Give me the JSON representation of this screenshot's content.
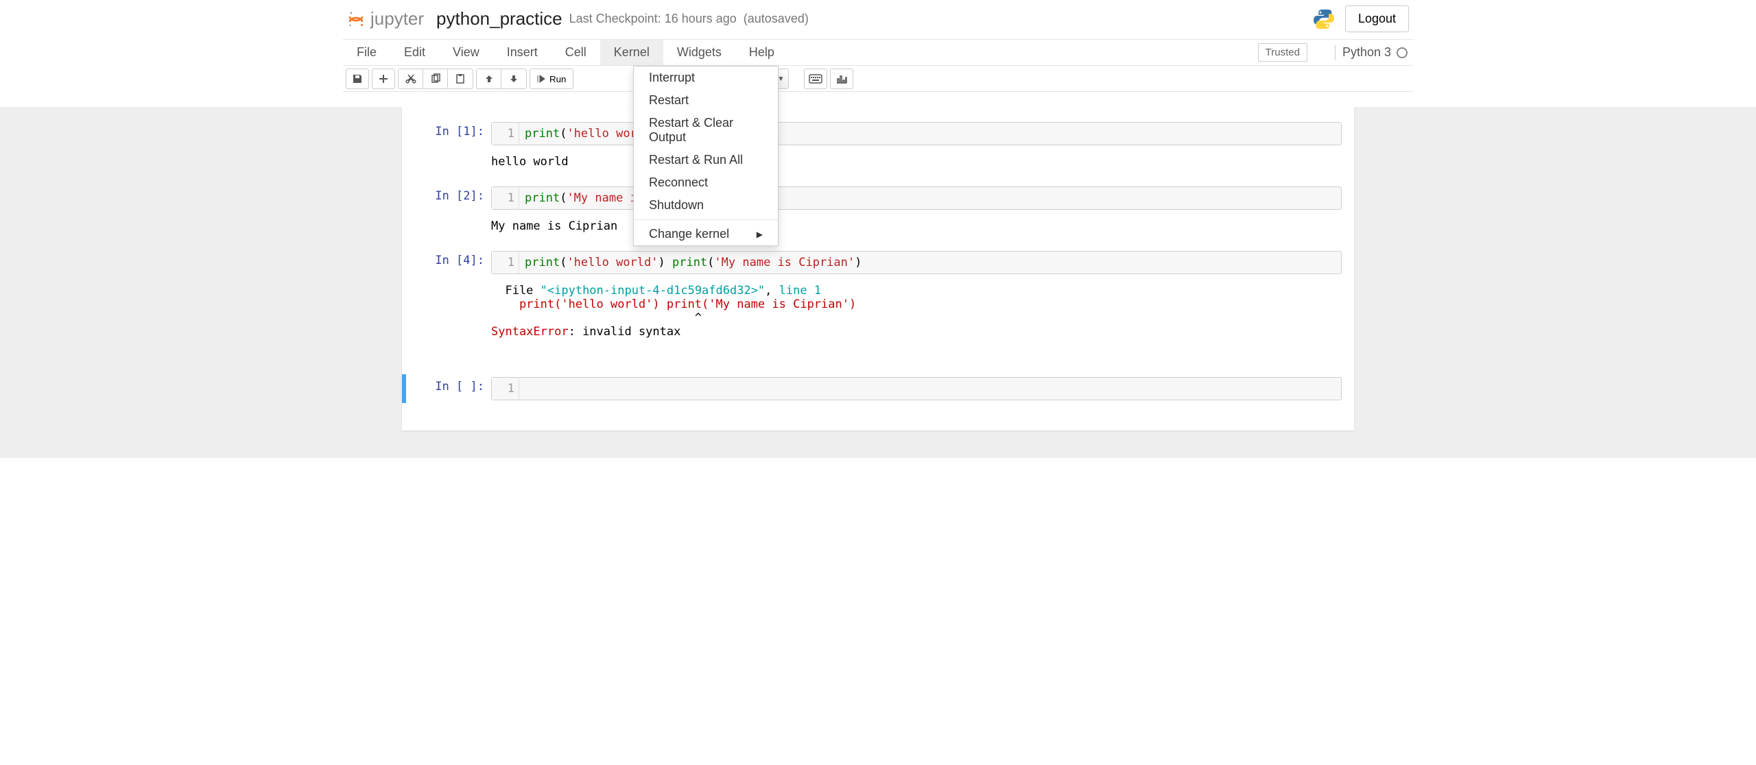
{
  "header": {
    "brand": "jupyter",
    "notebook_name": "python_practice",
    "checkpoint": "Last Checkpoint: 16 hours ago",
    "autosaved": "(autosaved)",
    "logout": "Logout"
  },
  "menubar": {
    "items": [
      "File",
      "Edit",
      "View",
      "Insert",
      "Cell",
      "Kernel",
      "Widgets",
      "Help"
    ],
    "active": "Kernel",
    "trusted": "Trusted",
    "kernel_name": "Python 3"
  },
  "kernel_menu": {
    "items": [
      "Interrupt",
      "Restart",
      "Restart & Clear Output",
      "Restart & Run All",
      "Reconnect",
      "Shutdown"
    ],
    "submenu": "Change kernel"
  },
  "toolbar": {
    "run_label": "Run",
    "celltype_selected": ""
  },
  "cells": [
    {
      "prompt": "In [1]:",
      "line_no": "1",
      "code_parts": {
        "fn": "print",
        "p1": "(",
        "s": "'hello world'",
        "p2": ")"
      },
      "output": "hello world"
    },
    {
      "prompt": "In [2]:",
      "line_no": "1",
      "code_parts": {
        "fn": "print",
        "p1": "(",
        "s": "'My name is Ciprian'",
        "p2": ")"
      },
      "output": "My name is Ciprian"
    },
    {
      "prompt": "In [4]:",
      "line_no": "1",
      "code_parts": {
        "fn1": "print",
        "p1a": "(",
        "s1": "'hello world'",
        "p1b": ") ",
        "fn2": "print",
        "p2a": "(",
        "s2": "'My name is Ciprian'",
        "p2b": ")"
      },
      "error": {
        "file_lead": "  File ",
        "file_name": "\"<ipython-input-4-d1c59afd6d32>\"",
        "sep": ", ",
        "line_label": "line 1",
        "echo": "    print('hello world') print('My name is Ciprian')",
        "caret": "                             ^",
        "err_name": "SyntaxError",
        "err_msg": ": invalid syntax"
      }
    },
    {
      "prompt": "In [ ]:",
      "line_no": "1",
      "code": ""
    }
  ]
}
